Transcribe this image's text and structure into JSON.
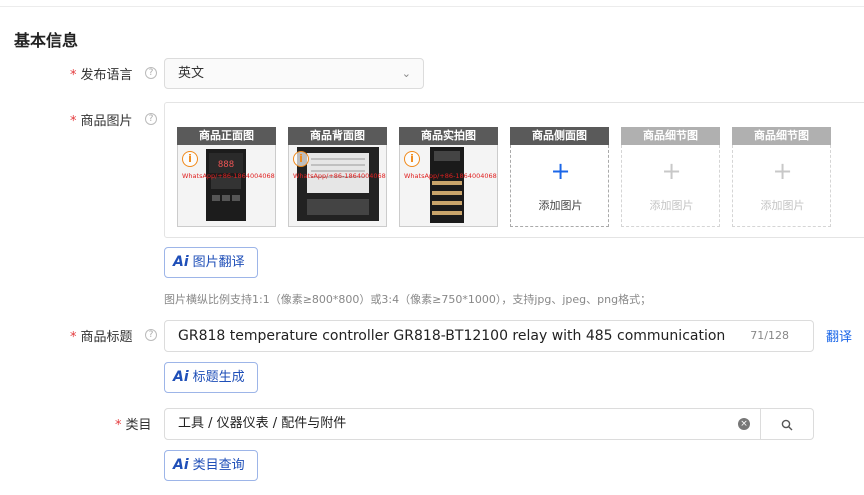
{
  "section": {
    "title": "基本信息"
  },
  "language": {
    "label": "发布语言",
    "required_mark": "*",
    "value": "英文",
    "icons": {
      "help": "question-circle-icon",
      "chevron": "chevron-down-icon"
    }
  },
  "images": {
    "label": "商品图片",
    "required_mark": "*",
    "slots": [
      {
        "title": "商品正面图",
        "filled": true,
        "watermark": "WhatsApp/+86-18640040688"
      },
      {
        "title": "商品背面图",
        "filled": true,
        "watermark": "WhatsApp/+86-18640040688"
      },
      {
        "title": "商品实拍图",
        "filled": true,
        "watermark": "WhatsApp/+86-18640040688"
      },
      {
        "title": "商品侧面图",
        "filled": false,
        "add_label": "添加图片",
        "enabled": true
      },
      {
        "title": "商品细节图",
        "filled": false,
        "add_label": "添加图片",
        "enabled": false
      },
      {
        "title": "商品细节图",
        "filled": false,
        "add_label": "添加图片",
        "enabled": false
      }
    ],
    "ai_button": "图片翻译",
    "hint": "图片横纵比例支持1:1（像素≥800*800）或3:4（像素≥750*1000），支持jpg、jpeg、png格式；"
  },
  "product_title": {
    "label": "商品标题",
    "required_mark": "*",
    "value": "GR818 temperature controller GR818-BT12100 relay with 485 communication",
    "counter": "71/128",
    "translate": "翻译",
    "ai_button": "标题生成"
  },
  "category": {
    "label": "类目",
    "required_mark": "*",
    "value": "工具 / 仪器仪表 / 配件与附件",
    "ai_button": "类目查询"
  },
  "ai_icon_text": "Ai",
  "colors": {
    "accent": "#1a66e8",
    "required": "#e4393c",
    "warning": "#f08a1c"
  }
}
